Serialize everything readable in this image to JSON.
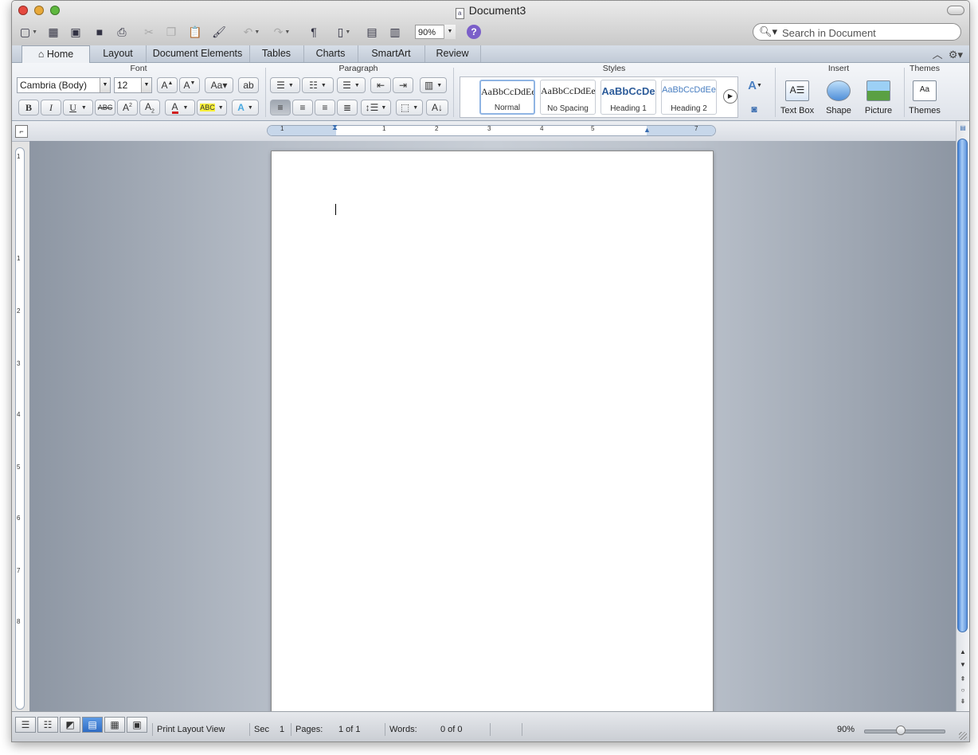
{
  "window": {
    "title": "Document3"
  },
  "toolbar": {
    "zoom": "90%",
    "search_placeholder": "Search in Document"
  },
  "tabs": [
    "Home",
    "Layout",
    "Document Elements",
    "Tables",
    "Charts",
    "SmartArt",
    "Review"
  ],
  "ribbon": {
    "groups": {
      "font": "Font",
      "paragraph": "Paragraph",
      "styles": "Styles",
      "insert": "Insert",
      "themes": "Themes"
    },
    "font_name": "Cambria (Body)",
    "font_size": "12",
    "styles": [
      {
        "preview": "AaBbCcDdEe",
        "label": "Normal"
      },
      {
        "preview": "AaBbCcDdEe",
        "label": "No Spacing"
      },
      {
        "preview": "AaBbCcDe",
        "label": "Heading 1"
      },
      {
        "preview": "AaBbCcDdEe",
        "label": "Heading 2"
      }
    ],
    "insert": [
      "Text Box",
      "Shape",
      "Picture"
    ],
    "themes_label": "Themes"
  },
  "ruler": {
    "h_numbers": [
      "1",
      "1",
      "2",
      "3",
      "4",
      "5",
      "7"
    ],
    "v_numbers": [
      "1",
      "1",
      "2",
      "3",
      "4",
      "5",
      "6",
      "7",
      "8"
    ]
  },
  "status": {
    "view": "Print Layout View",
    "sec_label": "Sec",
    "sec_value": "1",
    "pages_label": "Pages:",
    "pages_value": "1 of 1",
    "words_label": "Words:",
    "words_value": "0 of 0",
    "zoom": "90%"
  }
}
